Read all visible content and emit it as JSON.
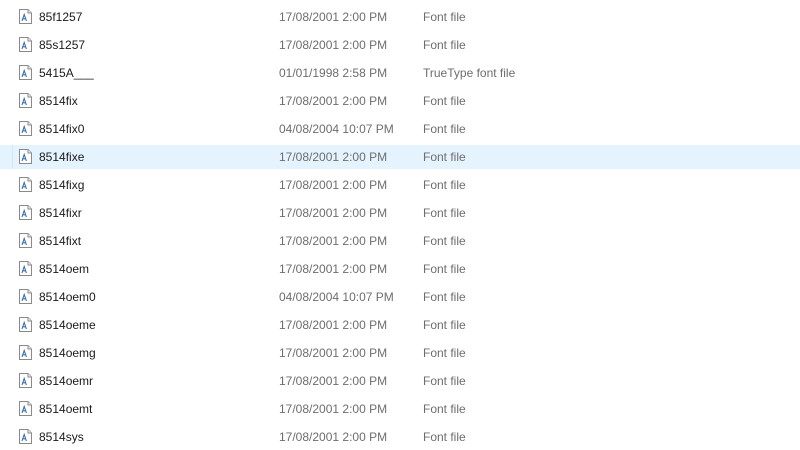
{
  "colors": {
    "selected_row_bg": "#e5f3ff",
    "secondary_text": "#6d6d6d",
    "primary_text": "#1a1a1a"
  },
  "file_list": {
    "icon": "font-file-icon",
    "rows": [
      {
        "name": "85f1257",
        "date": "17/08/2001 2:00 PM",
        "type": "Font file",
        "selected": false
      },
      {
        "name": "85s1257",
        "date": "17/08/2001 2:00 PM",
        "type": "Font file",
        "selected": false
      },
      {
        "name": "5415A___",
        "date": "01/01/1998 2:58 PM",
        "type": "TrueType font file",
        "selected": false
      },
      {
        "name": "8514fix",
        "date": "17/08/2001 2:00 PM",
        "type": "Font file",
        "selected": false
      },
      {
        "name": "8514fix0",
        "date": "04/08/2004 10:07 PM",
        "type": "Font file",
        "selected": false
      },
      {
        "name": "8514fixe",
        "date": "17/08/2001 2:00 PM",
        "type": "Font file",
        "selected": true
      },
      {
        "name": "8514fixg",
        "date": "17/08/2001 2:00 PM",
        "type": "Font file",
        "selected": false
      },
      {
        "name": "8514fixr",
        "date": "17/08/2001 2:00 PM",
        "type": "Font file",
        "selected": false
      },
      {
        "name": "8514fixt",
        "date": "17/08/2001 2:00 PM",
        "type": "Font file",
        "selected": false
      },
      {
        "name": "8514oem",
        "date": "17/08/2001 2:00 PM",
        "type": "Font file",
        "selected": false
      },
      {
        "name": "8514oem0",
        "date": "04/08/2004 10:07 PM",
        "type": "Font file",
        "selected": false
      },
      {
        "name": "8514oeme",
        "date": "17/08/2001 2:00 PM",
        "type": "Font file",
        "selected": false
      },
      {
        "name": "8514oemg",
        "date": "17/08/2001 2:00 PM",
        "type": "Font file",
        "selected": false
      },
      {
        "name": "8514oemr",
        "date": "17/08/2001 2:00 PM",
        "type": "Font file",
        "selected": false
      },
      {
        "name": "8514oemt",
        "date": "17/08/2001 2:00 PM",
        "type": "Font file",
        "selected": false
      },
      {
        "name": "8514sys",
        "date": "17/08/2001 2:00 PM",
        "type": "Font file",
        "selected": false
      }
    ]
  }
}
